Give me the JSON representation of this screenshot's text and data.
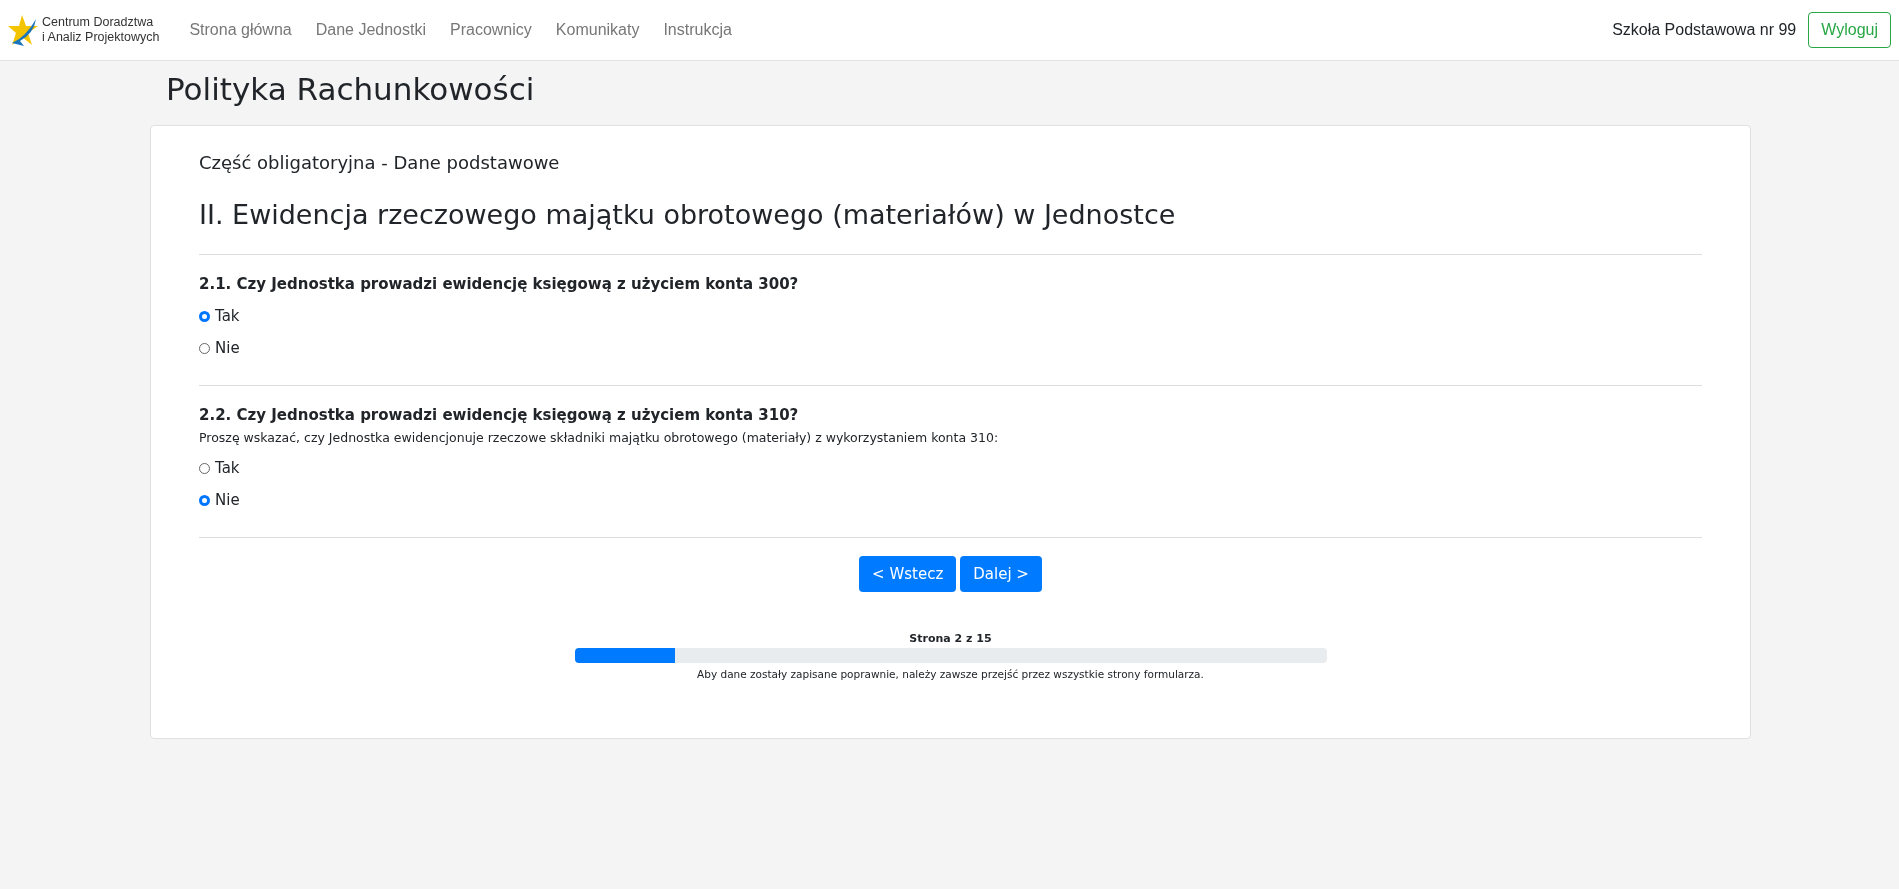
{
  "navbar": {
    "logo_lines": [
      "Centrum Doradztwa",
      "i Analiz Projektowych"
    ],
    "links": [
      {
        "label": "Strona główna",
        "selected": false
      },
      {
        "label": "Dane Jednostki",
        "selected": false
      },
      {
        "label": "Pracownicy",
        "selected": false
      },
      {
        "label": "Komunikaty",
        "selected": false
      },
      {
        "label": "Instrukcja",
        "selected": false
      }
    ],
    "user": "Szkoła Podstawowa nr 99",
    "logout": "Wyloguj"
  },
  "page_title": "Polityka Rachunkowości",
  "card": {
    "subtitle": "Część obligatoryjna - Dane podstawowe",
    "heading": "II. Ewidencja rzeczowego majątku obrotowego (materiałów) w Jednostce",
    "questions": [
      {
        "label": "2.1. Czy Jednostka prowadzi ewidencję księgową z użyciem konta 300?",
        "options": [
          {
            "label": "Tak",
            "selected": true
          },
          {
            "label": "Nie",
            "selected": false
          }
        ]
      },
      {
        "label": "2.2. Czy Jednostka prowadzi ewidencję księgową z użyciem konta 310?",
        "hint": "Proszę wskazać, czy Jednostka ewidencjonuje rzeczowe składniki majątku obrotowego (materiały) z wykorzystaniem konta 310:",
        "options": [
          {
            "label": "Tak",
            "selected": false
          },
          {
            "label": "Nie",
            "selected": true
          }
        ]
      }
    ],
    "buttons": [
      "< Wstecz",
      "Dalej >"
    ],
    "progress": {
      "label": "Strona 2 z 15",
      "level": 0.133,
      "note": "Aby dane zostały zapisane poprawnie, należy zawsze przejść przez wszystkie strony formularza."
    }
  }
}
